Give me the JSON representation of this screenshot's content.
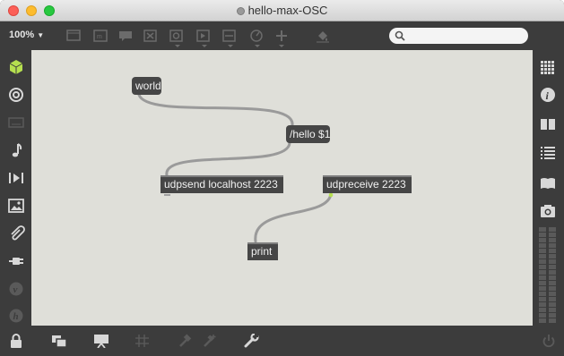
{
  "window": {
    "title": "hello-max-OSC"
  },
  "toolbar": {
    "zoom_label": "100%",
    "icons": [
      "presentation-icon",
      "comment-icon",
      "message-icon",
      "toggle-icon",
      "button-icon",
      "slider-icon",
      "number-icon",
      "dial-icon",
      "add-icon",
      "paint-bucket-icon"
    ],
    "search_placeholder": ""
  },
  "left_sidebar": {
    "icons": [
      "objects-cube-icon",
      "target-icon",
      "keyboard-icon",
      "music-note-icon",
      "play-media-icon",
      "image-icon",
      "paperclip-icon",
      "plug-icon",
      "vst-icon",
      "help-icon"
    ]
  },
  "right_sidebar": {
    "icons": [
      "grid-palette-icon",
      "info-icon",
      "book-icon",
      "list-icon",
      "reference-icon",
      "snapshot-icon"
    ]
  },
  "bottom_bar": {
    "icons": [
      "lock-icon",
      "windows-icon",
      "presentation-mode-icon",
      "grid-icon",
      "hammer-icon",
      "debug-icon",
      "wrench-icon",
      "power-icon"
    ]
  },
  "patch": {
    "objects": [
      {
        "id": "world",
        "kind": "message",
        "text": "world"
      },
      {
        "id": "hello",
        "kind": "message",
        "text": "/hello $1"
      },
      {
        "id": "udpsend",
        "kind": "object",
        "text": "udpsend localhost 2223"
      },
      {
        "id": "udpreceive",
        "kind": "object",
        "text": "udpreceive 2223"
      },
      {
        "id": "print",
        "kind": "object",
        "text": "print"
      }
    ],
    "connections": [
      {
        "from": "world",
        "to": "hello"
      },
      {
        "from": "hello",
        "to": "udpsend"
      },
      {
        "from": "udpreceive",
        "to": "print"
      }
    ]
  },
  "colors": {
    "canvas": "#dfdfd9",
    "chrome": "#3c3c3c",
    "object": "#464646",
    "patch_cord": "#9a9a9a",
    "accent_green": "#b6e04f"
  }
}
